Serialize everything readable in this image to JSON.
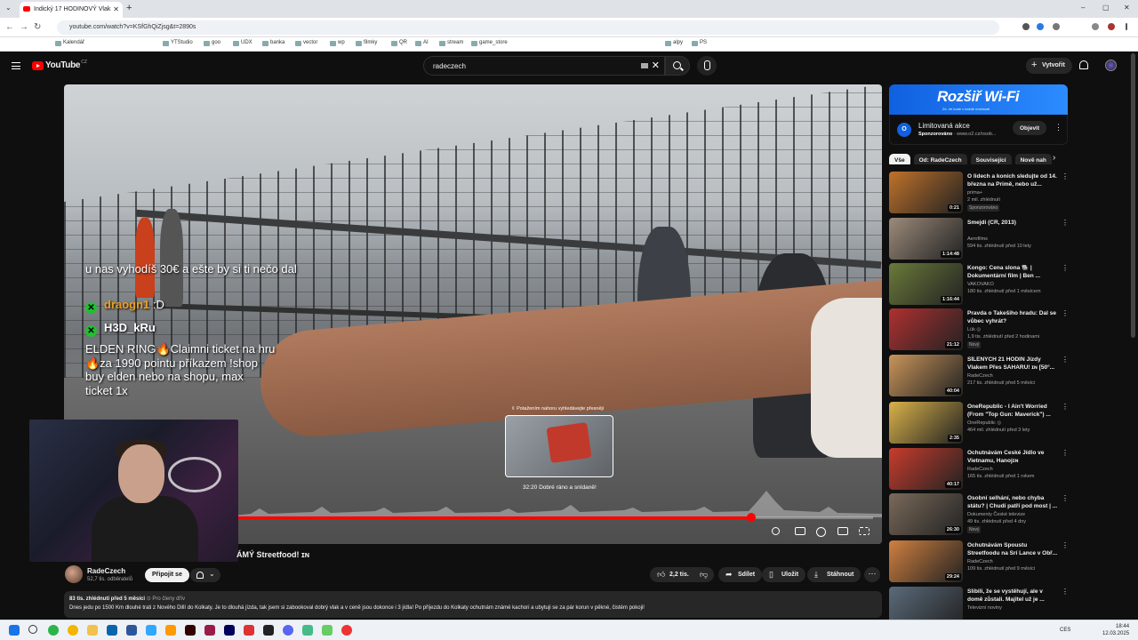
{
  "browser": {
    "tab_title": "Indický 17 HODINOVÝ Vlak",
    "url": "youtube.com/watch?v=KSfGhQiZjsg&t=2890s",
    "bookmarks": [
      "Kalendář",
      "YTStudio",
      "goo",
      "UDX",
      "banka",
      "vector",
      "wp",
      "filmky",
      "QR",
      "AI",
      "stream",
      "game_store",
      "alpy",
      "PS"
    ]
  },
  "header": {
    "logo": "YouTube",
    "country": "CZ",
    "search_value": "radeczech",
    "create_label": "Vytvořit"
  },
  "video": {
    "chat": {
      "msg1": "u nas vyhodíš 30€ a ešte by si ti nečo dal",
      "user1": "draogn1",
      "user1_msg": ":D",
      "user2": "H3D_kRu",
      "msg2_line1": "ELDEN RING🔥Claimni ticket na hru",
      "msg2_line2": "🔥za 1990 pointu příkazem !shop",
      "msg2_line3": "buy elden nebo na shopu, max",
      "msg2_line4": "ticket 1x"
    },
    "preview_hint": "⇳ Potažením nahoru vyhledávejte přesněji",
    "preview_time": "32:20  Dobré ráno a snídaně!",
    "progress": 0.81,
    "hover_position": 0.6
  },
  "below": {
    "title_tail": "ÁMÝ Streetfood! ",
    "title_badge": "ɪɴ",
    "channel_name": "RadeCzech",
    "channel_subs": "52,7 tis. odběratelů",
    "join_label": "Připojit se",
    "like_count": "2,2 tis.",
    "share_label": "Sdílet",
    "save_label": "Uložit",
    "download_label": "Stáhnout",
    "views_age": "83 tis. zhlédnutí  před 5 měsíci",
    "members_label": "Pro členy dřív",
    "description": "Dnes jedu po 1500 Km dlouhé trati z Nového Dillí do Kolkaty. Je to dlouhá jízda, tak jsem si zabookoval dobrý vlak a v ceně jsou dokonce i 3 jídla! Po příjezdu do Kolkaty ochutnám známé kachori a ubytuji se za pár korun v pěkné, čistém pokoji!"
  },
  "sidebar": {
    "ad": {
      "banner_text": "Rozšiř Wi-Fi",
      "banner_sub": "Ze, že bude v každé místnosti",
      "title": "Limitovaná akce",
      "sponsored": "Sponzorováno",
      "domain": "www.o2.cz/osob...",
      "cta": "Objevit",
      "logo_letter": "O"
    },
    "chips": [
      "Vše",
      "Od: RadeCzech",
      "Související",
      "Nově nah"
    ],
    "recommendations": [
      {
        "title": "O lidech a koních sledujte od 14. března na Primě, nebo už...",
        "channel": "prima+",
        "meta": "2 mil. zhlédnutí",
        "badge": "Sponzorováno",
        "duration": "0:21",
        "color": "#c0722a"
      },
      {
        "title": "Šmejdi (ČR, 2013)",
        "channel": "Aerofilms",
        "meta": "594 tis. zhlédnutí  před 10 lety",
        "badge": "",
        "duration": "1:14:48",
        "color": "#9c8b7a"
      },
      {
        "title": "Kongo: Cena slona 🐘 | Dokumentární film | Ben ...",
        "channel": "VAKOVAKO",
        "meta": "180 tis. zhlédnutí  před 1 měsícem",
        "badge": "",
        "duration": "1:16:44",
        "color": "#6a7a3a"
      },
      {
        "title": "Pravda o Takešiho hradu: Dal se vůbec vyhrát?",
        "channel": "Lük ◎",
        "meta": "1,9 tis. zhlédnutí  před 2 hodinami",
        "badge": "Nový",
        "duration": "21:12",
        "color": "#b03030"
      },
      {
        "title": "ŠÍLENÝCH 21 HODIN Jízdy Vlakem Přes SAHARU! ɪɴ [50°...",
        "channel": "RadeCzech",
        "meta": "217 tis. zhlédnutí  před 5 měsíci",
        "badge": "",
        "duration": "40:04",
        "color": "#c9955a"
      },
      {
        "title": "OneRepublic - I Ain't Worried (From \"Top Gun: Maverick\") ...",
        "channel": "OneRepublic ◎",
        "meta": "464 mil. zhlédnutí  před 3 lety",
        "badge": "",
        "duration": "2:35",
        "color": "#d9b24a"
      },
      {
        "title": "Ochutnávám České Jídlo ve Vietnamu, Hanojɪɴ",
        "channel": "RadeCzech",
        "meta": "165 tis. zhlédnutí  před 1 rokem",
        "badge": "",
        "duration": "40:17",
        "color": "#c83c2c"
      },
      {
        "title": "Osobní selhání, nebo chyba státu? | Chudí patří pod most | ...",
        "channel": "Dokumenty České televize",
        "meta": "49 tis. zhlédnutí  před 4 dny",
        "badge": "Nový",
        "duration": "26:30",
        "color": "#7a6a5a"
      },
      {
        "title": "Ochutnávám Spoustu Streetfoodu na Srí Lance v Obř...",
        "channel": "RadeCzech",
        "meta": "109 tis. zhlédnutí  před 9 měsíci",
        "badge": "",
        "duration": "29:24",
        "color": "#d08040"
      },
      {
        "title": "Slibili, že se vystěhují, ale v domě zůstali. Majitel už je ...",
        "channel": "Televizní noviny",
        "meta": "",
        "badge": "",
        "duration": "",
        "color": "#5a6a7a"
      }
    ]
  },
  "taskbar": {
    "lang": "CES",
    "time": "18:44",
    "date": "12.03.2025"
  },
  "colors": {
    "accent": "#ff0000",
    "bg": "#0f0f0f",
    "chip": "#272727"
  }
}
